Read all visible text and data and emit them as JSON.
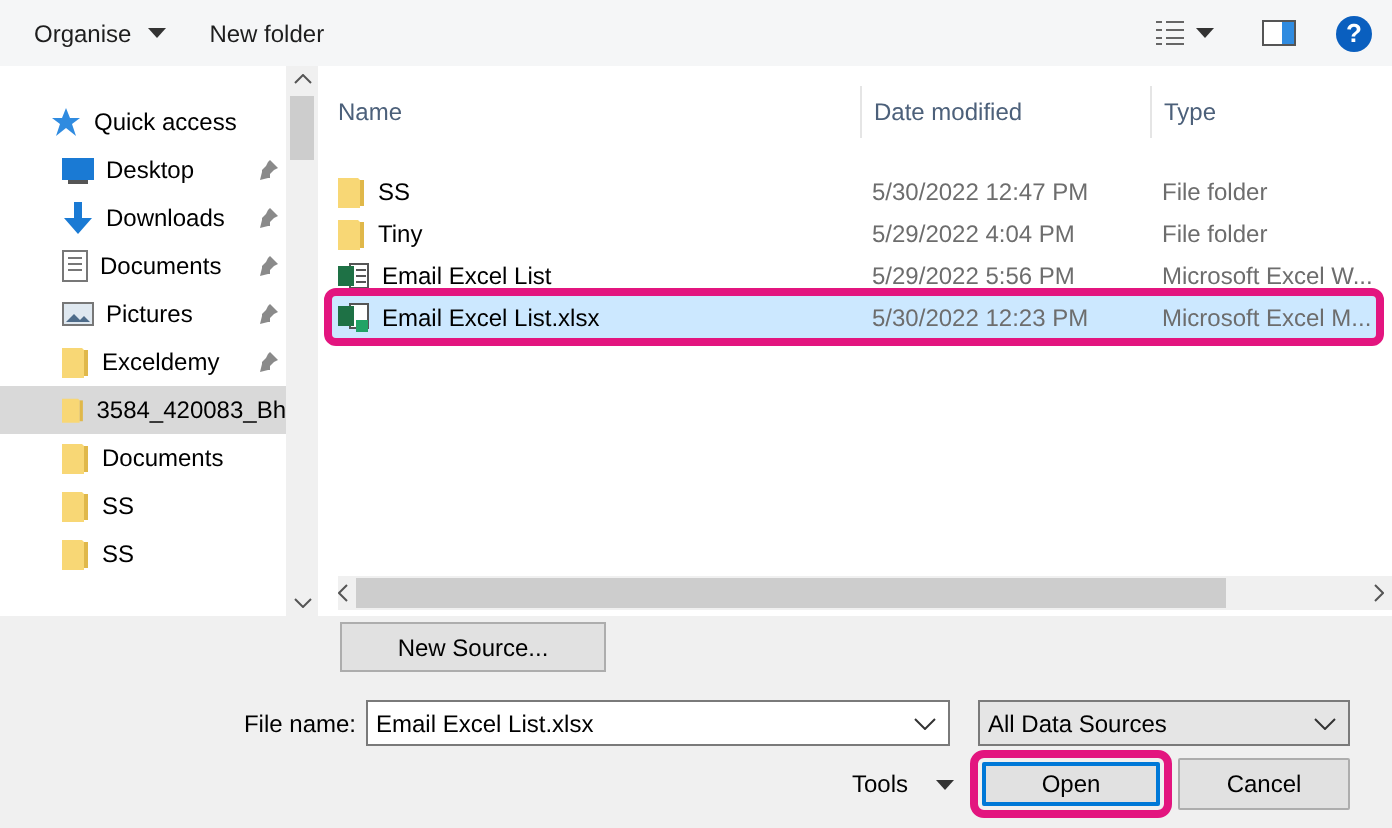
{
  "toolbar": {
    "organise": "Organise",
    "new_folder": "New folder",
    "help": "?"
  },
  "sidebar": {
    "items": [
      {
        "label": "Quick access",
        "kind": "star",
        "pinned": false,
        "selected": false
      },
      {
        "label": "Desktop",
        "kind": "desktop",
        "pinned": true,
        "selected": false
      },
      {
        "label": "Downloads",
        "kind": "download",
        "pinned": true,
        "selected": false
      },
      {
        "label": "Documents",
        "kind": "document",
        "pinned": true,
        "selected": false
      },
      {
        "label": "Pictures",
        "kind": "picture",
        "pinned": true,
        "selected": false
      },
      {
        "label": "Exceldemy",
        "kind": "folder",
        "pinned": true,
        "selected": false
      },
      {
        "label": "3584_420083_Bh",
        "kind": "folder",
        "pinned": false,
        "selected": true
      },
      {
        "label": "Documents",
        "kind": "folder",
        "pinned": false,
        "selected": false
      },
      {
        "label": "SS",
        "kind": "folder",
        "pinned": false,
        "selected": false
      },
      {
        "label": "SS",
        "kind": "folder",
        "pinned": false,
        "selected": false
      }
    ]
  },
  "table": {
    "columns": [
      "Name",
      "Date modified",
      "Type"
    ],
    "rows": [
      {
        "name": "SS",
        "date": "5/30/2022 12:47 PM",
        "type": "File folder",
        "kind": "folder",
        "selected": false,
        "annotated": false
      },
      {
        "name": "Tiny",
        "date": "5/29/2022 4:04 PM",
        "type": "File folder",
        "kind": "folder",
        "selected": false,
        "annotated": false
      },
      {
        "name": "Email Excel List",
        "date": "5/29/2022 5:56 PM",
        "type": "Microsoft Excel W...",
        "kind": "excel",
        "selected": false,
        "annotated": false
      },
      {
        "name": "Email Excel List.xlsx",
        "date": "5/30/2022 12:23 PM",
        "type": "Microsoft Excel M...",
        "kind": "excel-macro",
        "selected": true,
        "annotated": true
      }
    ]
  },
  "new_source": "New Source...",
  "file_name": {
    "label": "File name:",
    "value": "Email Excel List.xlsx"
  },
  "filter": {
    "value": "All Data Sources"
  },
  "tools": "Tools",
  "buttons": [
    {
      "label": "Open",
      "default": true,
      "annotated": true
    },
    {
      "label": "Cancel",
      "default": false,
      "annotated": false
    }
  ]
}
